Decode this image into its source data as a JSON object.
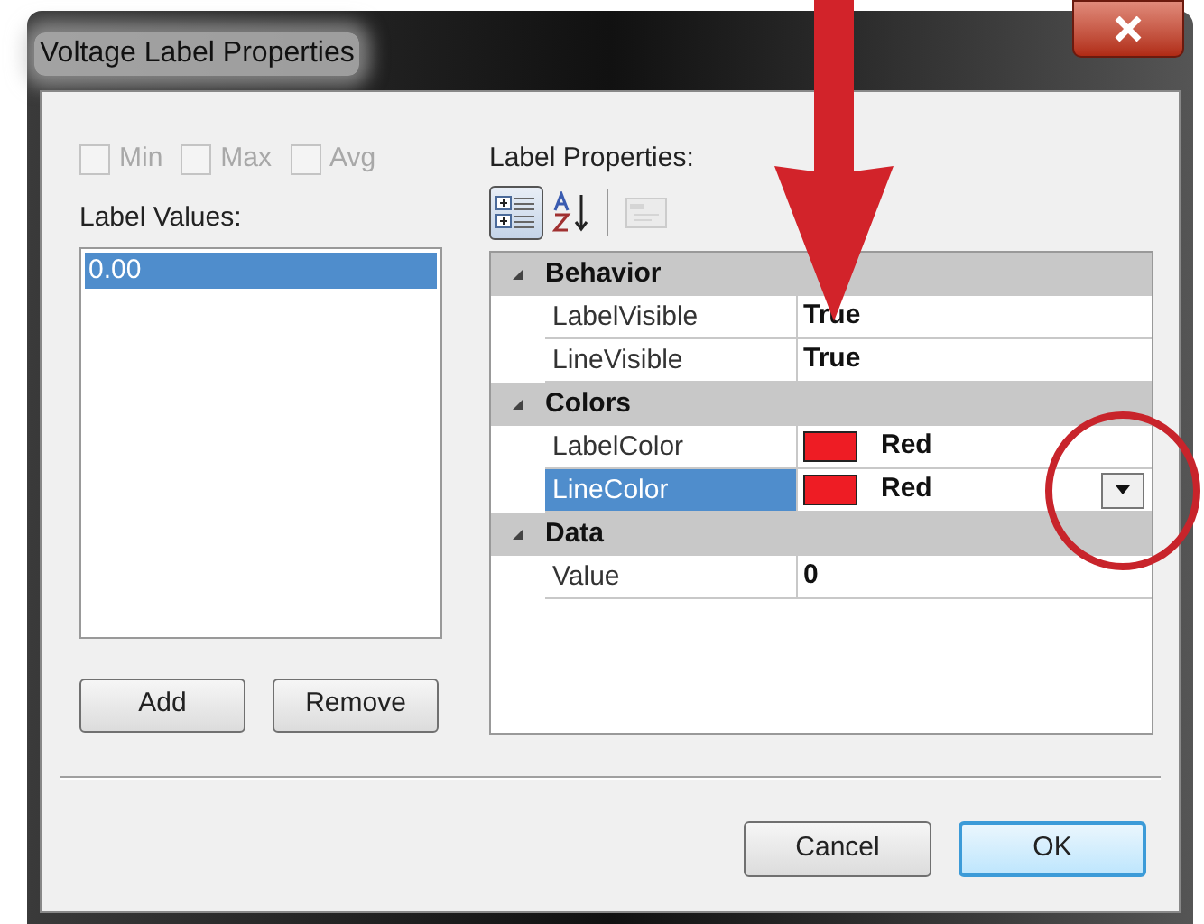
{
  "window": {
    "title": "Voltage Label Properties"
  },
  "options": [
    {
      "label": "Min",
      "checked": false,
      "disabled": true
    },
    {
      "label": "Max",
      "checked": false,
      "disabled": true
    },
    {
      "label": "Avg",
      "checked": false,
      "disabled": true
    }
  ],
  "label_values": {
    "label": "Label Values:",
    "items": [
      {
        "text": "0.00",
        "selected": true
      }
    ]
  },
  "list_buttons": [
    "Add",
    "Remove"
  ],
  "properties": {
    "label": "Label Properties:",
    "toolbar": [
      {
        "kind": "categorized",
        "selected": true,
        "disabled": false
      },
      {
        "kind": "alphabetical",
        "selected": false,
        "disabled": false
      },
      {
        "kind": "pages",
        "selected": false,
        "disabled": true
      }
    ],
    "categories": [
      {
        "name": "Behavior",
        "expanded": true,
        "rows": [
          {
            "name": "LabelVisible",
            "value": "True",
            "selected": false
          },
          {
            "name": "LineVisible",
            "value": "True",
            "selected": false
          }
        ]
      },
      {
        "name": "Colors",
        "expanded": true,
        "rows": [
          {
            "name": "LabelColor",
            "value": "Red",
            "color": "#ee1c24",
            "selected": false
          },
          {
            "name": "LineColor",
            "value": "Red",
            "color": "#ee1c24",
            "selected": true
          }
        ]
      },
      {
        "name": "Data",
        "expanded": true,
        "rows": [
          {
            "name": "Value",
            "value": "0",
            "selected": false
          }
        ]
      }
    ]
  },
  "buttons": [
    {
      "label": "Cancel",
      "default": false
    },
    {
      "label": "OK",
      "default": true
    }
  ]
}
